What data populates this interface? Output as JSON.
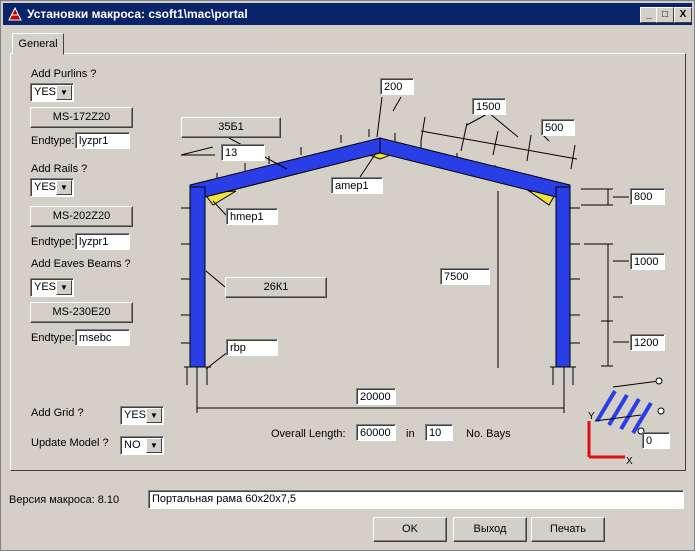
{
  "window": {
    "title": "Установки макроса: csoft1\\mac\\portal"
  },
  "titlebar_buttons": {
    "min": "_",
    "max": "□",
    "close": "X"
  },
  "tabs": [
    {
      "label": "General"
    }
  ],
  "left": {
    "purlins": {
      "label": "Add Purlins ?",
      "value": "YES",
      "section": "MS-172Z20",
      "endtype_label": "Endtype:",
      "endtype": "lyzpr1"
    },
    "rails": {
      "label": "Add Rails ?",
      "value": "YES",
      "section": "MS-202Z20",
      "endtype_label": "Endtype:",
      "endtype": "lyzpr1"
    },
    "eaves": {
      "label": "Add Eaves Beams ?",
      "value": "YES",
      "section": "MS-230E20",
      "endtype_label": "Endtype:",
      "endtype": "msebc"
    },
    "grid": {
      "label": "Add Grid ?",
      "value": "YES"
    },
    "update": {
      "label": "Update Model ?",
      "value": "NO"
    }
  },
  "frame": {
    "rafter_section": "35Б1",
    "slope": "13",
    "apex_haunch": "amep1",
    "eave_haunch": "hmep1",
    "column_section": "26К1",
    "base": "rbp",
    "apex_offset": "200",
    "purlin_spacing": "1500",
    "purlin_edge": "500",
    "eave_height_top": "800",
    "rail_spacing": "1000",
    "rail_bottom": "1200",
    "height": "7500",
    "span": "20000"
  },
  "bottom": {
    "overall_length_label": "Overall Length:",
    "overall_length": "60000",
    "in_label": "in",
    "bays": "10",
    "bays_label": "No. Bays",
    "grid_offset": "0",
    "axis_x": "X",
    "axis_y": "Y"
  },
  "footer": {
    "version_label": "Версия макроса: 8.10",
    "description": "Портальная рама 60х20х7,5",
    "ok": "OK",
    "exit": "Выход",
    "print": "Печать"
  },
  "colors": {
    "titlebar": "#0a246a",
    "steel": "#2a3ee8",
    "haunch": "#f0e040",
    "axis": "#e01010"
  }
}
